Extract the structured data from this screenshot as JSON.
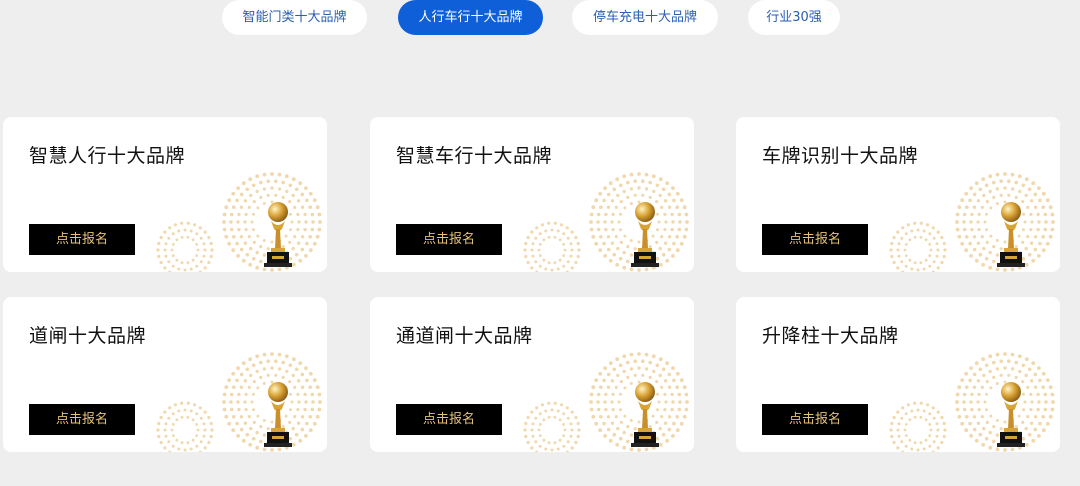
{
  "tabs": [
    {
      "label": "智能门类十大品牌",
      "active": false
    },
    {
      "label": "人行车行十大品牌",
      "active": true
    },
    {
      "label": "停车充电十大品牌",
      "active": false
    },
    {
      "label": "行业30强",
      "active": false
    }
  ],
  "cards": [
    {
      "title": "智慧人行十大品牌",
      "button": "点击报名"
    },
    {
      "title": "智慧车行十大品牌",
      "button": "点击报名"
    },
    {
      "title": "车牌识别十大品牌",
      "button": "点击报名"
    },
    {
      "title": "道闸十大品牌",
      "button": "点击报名"
    },
    {
      "title": "通道闸十大品牌",
      "button": "点击报名"
    },
    {
      "title": "升降柱十大品牌",
      "button": "点击报名"
    }
  ],
  "colors": {
    "accent": "#0e5fd8",
    "button_bg": "#000000",
    "button_text": "#e6c27a",
    "trophy_gold": "#d9a437",
    "dots": "#f0d8ae"
  },
  "icons": {
    "card_decoration": "trophy-icon"
  }
}
